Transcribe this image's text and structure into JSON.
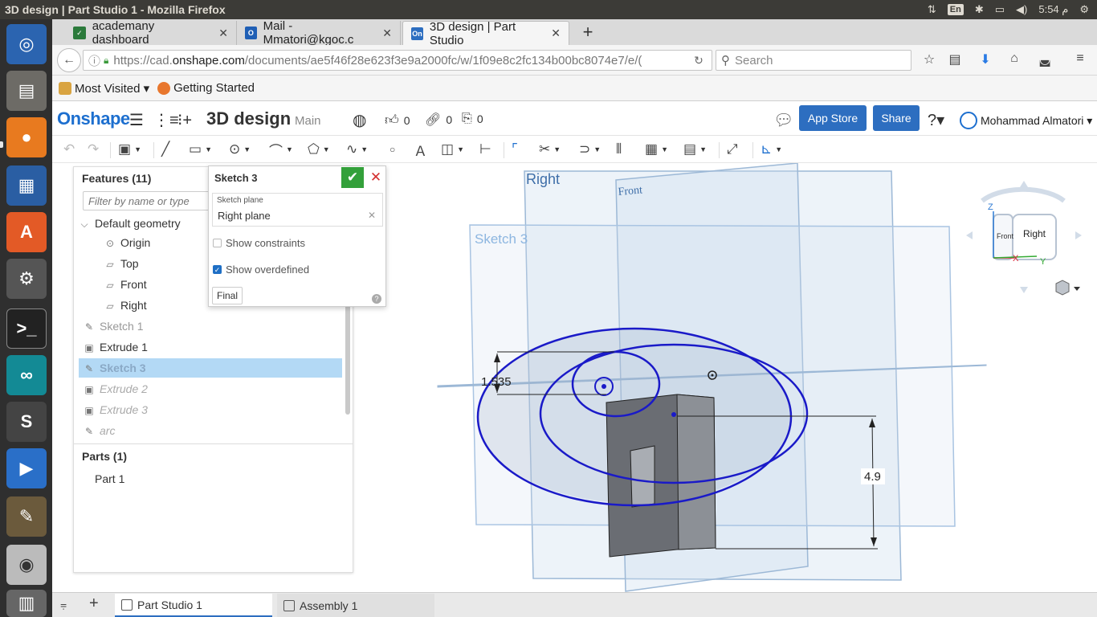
{
  "os": {
    "window_title": "3D design | Part Studio 1 - Mozilla Firefox",
    "lang": "En",
    "time": "5:54 م"
  },
  "browser": {
    "tabs": [
      {
        "label": "academany dashboard",
        "favicon_color": "#2b7a3b"
      },
      {
        "label": "Mail - Mmatori@kgoc.c",
        "favicon_color": "#1f5fb5"
      },
      {
        "label": "3D design | Part Studio",
        "favicon_color": "#2d6ec0"
      }
    ],
    "url": {
      "prefix": "https://cad.",
      "host": "onshape.com",
      "path": "/documents/ae5f46f28e623f3e9a2000fc/w/1f09e8c2fc134b00bc8074e7/e/("
    },
    "search_placeholder": "Search",
    "bookmarks": [
      {
        "label": "Most Visited ▾"
      },
      {
        "label": "Getting Started"
      }
    ]
  },
  "header": {
    "logo": "Onshape",
    "doc_title": "3D design",
    "branch": "Main",
    "likes": "0",
    "links": "0",
    "copies": "0",
    "app_store": "App Store",
    "share": "Share",
    "user": "Mohammad Almatori ▾"
  },
  "features": {
    "title": "Features (11)",
    "filter_placeholder": "Filter by name or type",
    "items": [
      {
        "label": "Default geometry"
      },
      {
        "label": "Origin"
      },
      {
        "label": "Top"
      },
      {
        "label": "Front"
      },
      {
        "label": "Right"
      },
      {
        "label": "Sketch 1"
      },
      {
        "label": "Extrude 1"
      },
      {
        "label": "Sketch 3"
      },
      {
        "label": "Extrude 2"
      },
      {
        "label": "Extrude 3"
      },
      {
        "label": "arc"
      }
    ],
    "parts_title": "Parts (1)",
    "parts": [
      {
        "label": "Part 1"
      }
    ]
  },
  "sketch_dialog": {
    "title": "Sketch 3",
    "plane_label": "Sketch plane",
    "plane_value": "Right plane",
    "show_constraints": "Show constraints",
    "show_overdefined": "Show overdefined",
    "final": "Final",
    "show_constraints_checked": false,
    "show_overdefined_checked": true
  },
  "viewport": {
    "plane_right": "Right",
    "plane_front": "Front",
    "plane_sketch": "Sketch 3",
    "dim_1": "1.535",
    "dim_2": "4.9",
    "cube_front": "Front",
    "cube_right": "Right",
    "axis_z": "Z",
    "axis_x": "X",
    "axis_y": "Y",
    "sketch_color": "#1a1ac8"
  },
  "bottom_tabs": [
    {
      "label": "Part Studio 1"
    },
    {
      "label": "Assembly 1"
    }
  ]
}
